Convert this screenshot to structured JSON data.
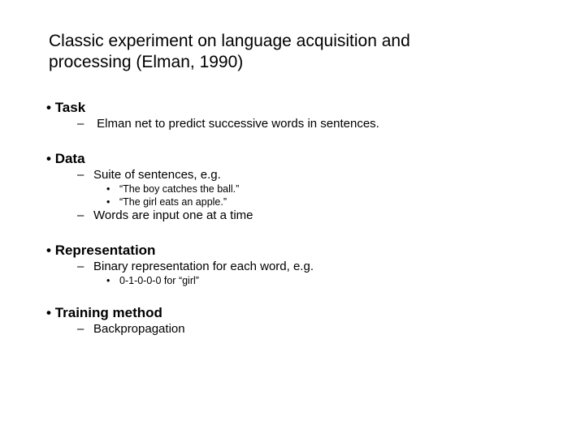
{
  "slide": {
    "title_line1": "Classic experiment on language acquisition and",
    "title_line2": "processing (Elman, 1990)",
    "bullet_symbol": "•",
    "dash_symbol": "–",
    "sections": [
      {
        "heading": "Task",
        "items": [
          {
            "text": " Elman net to predict successive words in sentences.",
            "subitems": []
          }
        ]
      },
      {
        "heading": "Data",
        "items": [
          {
            "text": "Suite of sentences, e.g.",
            "subitems": [
              "“The boy catches the ball.”",
              "“The girl eats an apple.”"
            ]
          },
          {
            "text": "Words are input one at a time",
            "subitems": []
          }
        ]
      },
      {
        "heading": "Representation",
        "items": [
          {
            "text": "Binary representation for each word, e.g.",
            "subitems": [
              "0-1-0-0-0 for “girl”"
            ]
          }
        ]
      },
      {
        "heading": "Training method",
        "items": [
          {
            "text": "Backpropagation",
            "subitems": []
          }
        ]
      }
    ]
  }
}
